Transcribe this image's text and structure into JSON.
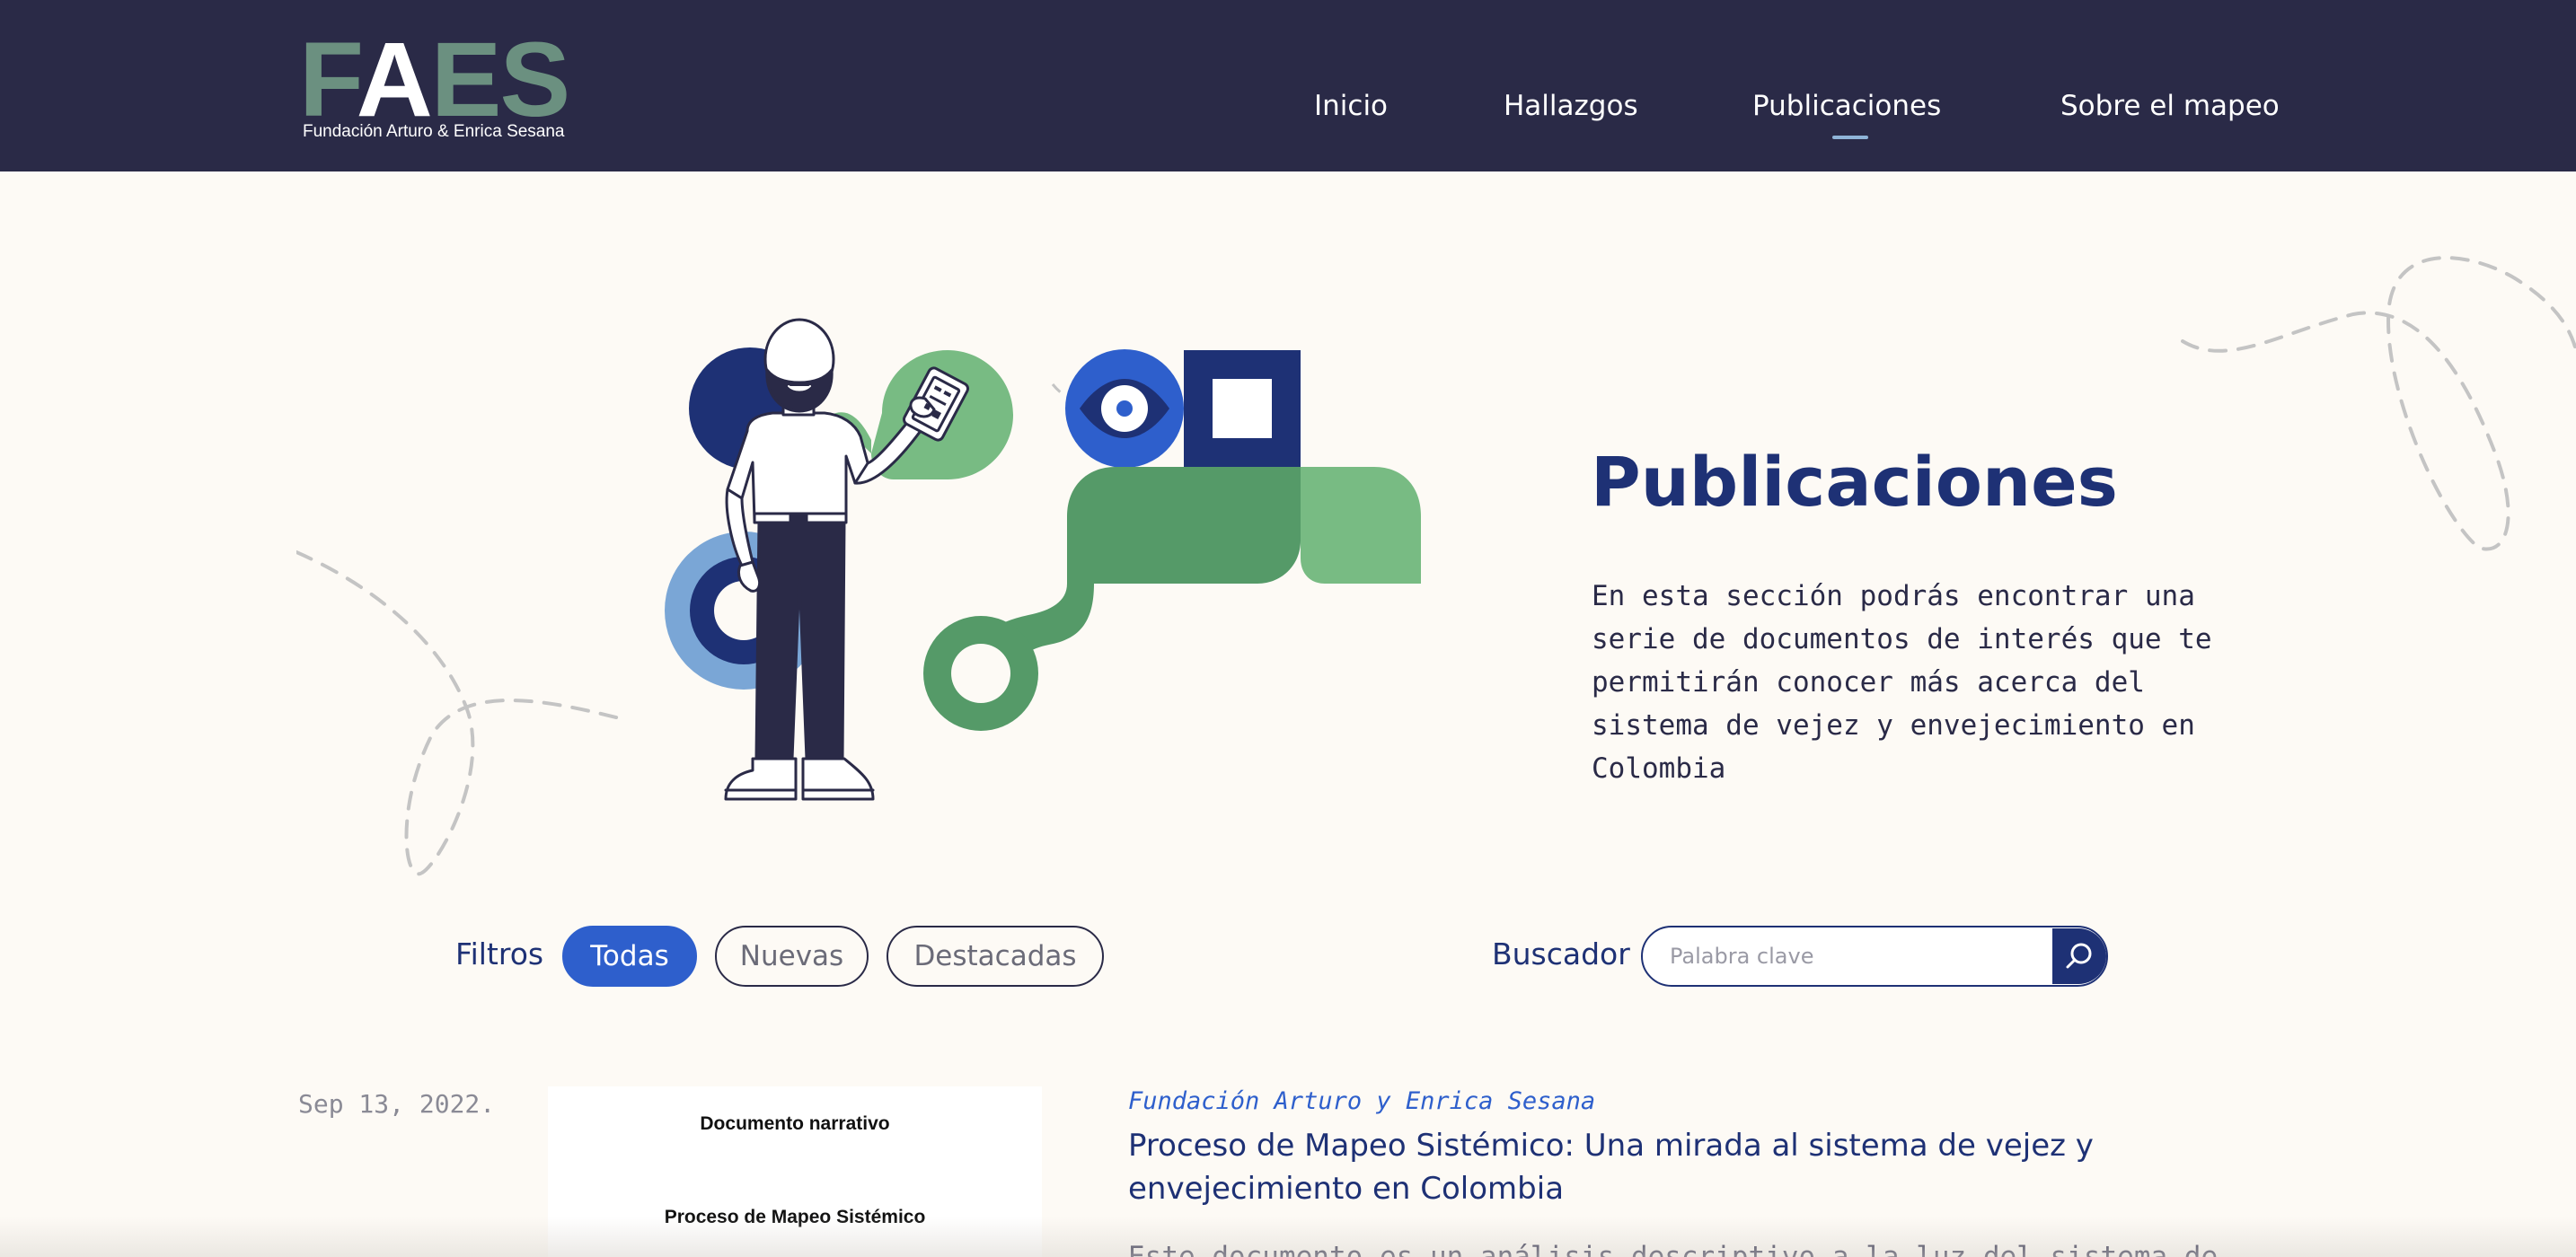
{
  "header": {
    "logo": {
      "mark_a": "F",
      "mark_b": "A",
      "mark_c": "ES",
      "subtitle": "Fundación Arturo & Enrica Sesana"
    },
    "nav": [
      {
        "label": "Inicio"
      },
      {
        "label": "Hallazgos"
      },
      {
        "label": "Publicaciones",
        "active": true
      },
      {
        "label": "Sobre el mapeo"
      }
    ]
  },
  "hero": {
    "title": "Publicaciones",
    "description": "En esta sección podrás encontrar una serie de documentos de interés que te permitirán conocer más acerca del sistema de vejez y envejecimiento en Colombia"
  },
  "filters": {
    "label": "Filtros",
    "options": [
      {
        "label": "Todas",
        "active": true
      },
      {
        "label": "Nuevas",
        "active": false
      },
      {
        "label": "Destacadas",
        "active": false
      }
    ]
  },
  "search": {
    "label": "Buscador",
    "placeholder": "Palabra clave",
    "value": ""
  },
  "publications": [
    {
      "date": "Sep 13, 2022.",
      "thumbnail": {
        "line1": "Documento narrativo",
        "line2": "Proceso de Mapeo Sistémico"
      },
      "source": "Fundación Arturo y Enrica Sesana",
      "title": "Proceso de Mapeo Sistémico: Una mirada al sistema de vejez y envejecimiento en Colombia",
      "excerpt": "Este documento es un análisis descriptivo a la luz del sistema de"
    }
  ],
  "colors": {
    "header_bg": "#2a2a47",
    "page_bg": "#fdfaf5",
    "primary_navy": "#1e3175",
    "accent_blue": "#2e5fcc",
    "green_dark": "#559a68",
    "green_light": "#78bb83",
    "logo_green": "#6b9080"
  },
  "icons": {
    "search_button": "search-icon",
    "hero": "person-holding-phone-illustration"
  }
}
